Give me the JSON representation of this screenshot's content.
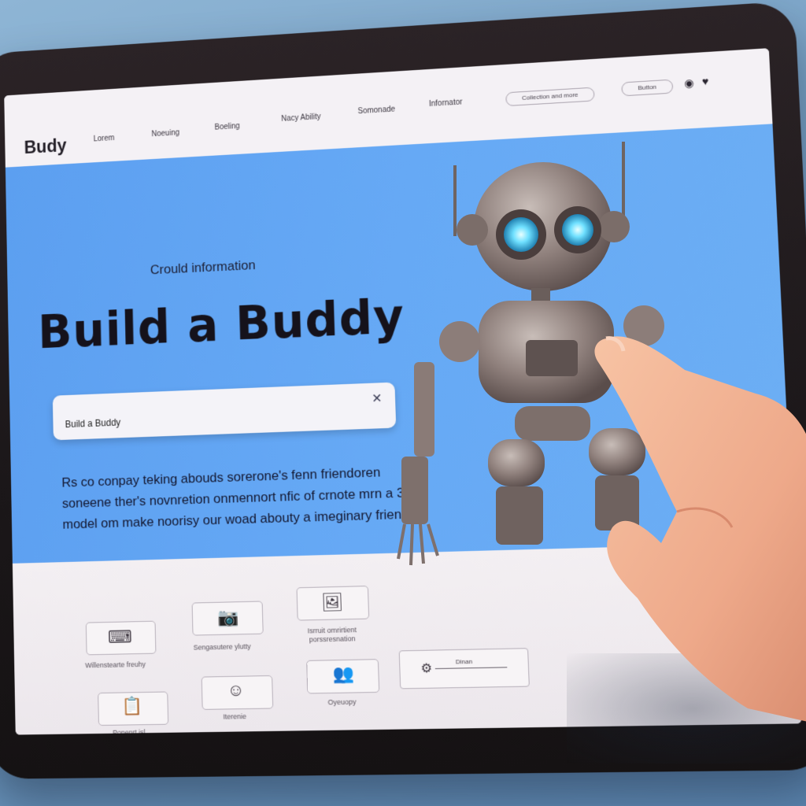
{
  "brand": "Budy",
  "nav": {
    "items": [
      "Lorem",
      "Noeuing",
      "Boeling",
      "Nacy Ability",
      "Somonade",
      "Infornator"
    ],
    "search": "Collection and more",
    "pill": "Button",
    "icons": [
      "circle-icon",
      "heart-icon"
    ]
  },
  "hero": {
    "eyebrow": "Crould information",
    "title": "Build a Buddy",
    "search_value": "Build a Buddy",
    "description": "Rs co conpay teking abouds sorerone's fenn friendoren soneene ther's novnretion onmennort nfic of crnote mrn a 3D model om make noorisy our woad abouty a imeginary friend"
  },
  "features": [
    {
      "icon": "keyboard-icon",
      "label": "Willenstearte freuhy"
    },
    {
      "icon": "camera-icon",
      "label": "Sengasutere ylutty"
    },
    {
      "icon": "photo-icon",
      "label": "Isrruit omrirtient porssresnation"
    },
    {
      "icon": "clipboard-icon",
      "label": "Ponenrt isl"
    },
    {
      "icon": "face-icon",
      "label": "Iterenie"
    },
    {
      "icon": "people-icon",
      "label": "Oyeuopy"
    }
  ],
  "dialog": {
    "icon": "gear-icon",
    "label": "Dinan"
  },
  "colors": {
    "hero": "#62a6f3",
    "frame": "#1d1819",
    "screen": "#f2eef1"
  }
}
